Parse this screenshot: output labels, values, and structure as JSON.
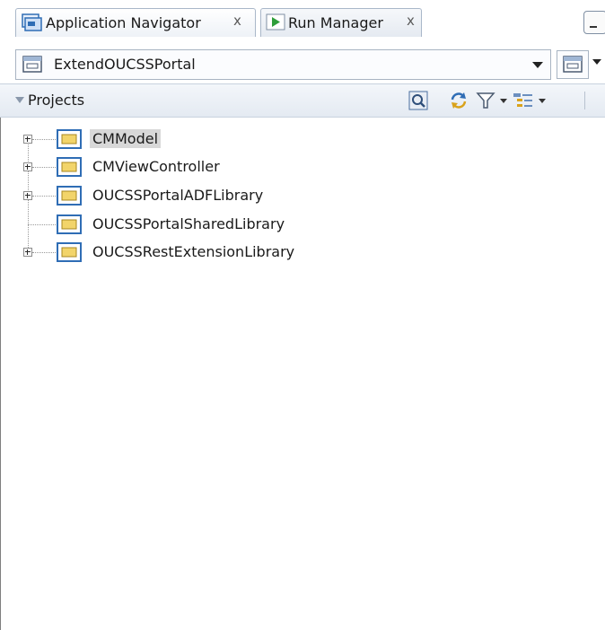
{
  "tabs": [
    {
      "label": "Application Navigator",
      "close": "x",
      "active": true,
      "icon": "application-navigator-icon"
    },
    {
      "label": "Run Manager",
      "close": "x",
      "active": false,
      "icon": "run-play-icon"
    }
  ],
  "application_selector": {
    "value": "ExtendOUCSSPortal",
    "icon": "application-icon"
  },
  "projects_panel": {
    "title": "Projects",
    "toolbar_icons": [
      "search-navigator-icon",
      "refresh-icon",
      "filter-icon",
      "working-set-icon"
    ]
  },
  "tree": [
    {
      "label": "CMModel",
      "expandable": true,
      "selected": true
    },
    {
      "label": "CMViewController",
      "expandable": true,
      "selected": false
    },
    {
      "label": "OUCSSPortalADFLibrary",
      "expandable": true,
      "selected": false
    },
    {
      "label": "OUCSSPortalSharedLibrary",
      "expandable": false,
      "selected": false
    },
    {
      "label": "OUCSSRestExtensionLibrary",
      "expandable": true,
      "selected": false
    }
  ],
  "colors": {
    "accent_blue": "#2f6db5",
    "folder_yellow": "#f2d46a",
    "selection_gray": "#d8d8d8",
    "play_green": "#2e9e3a"
  }
}
